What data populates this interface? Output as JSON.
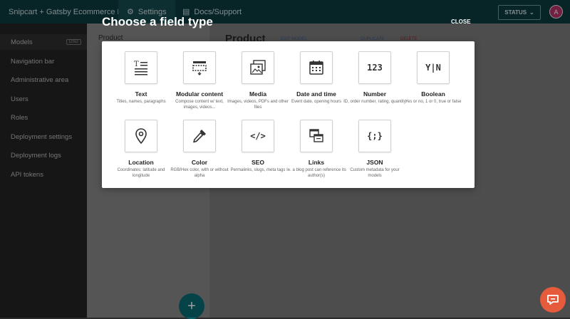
{
  "app": {
    "project_name": "Snipcart + Gatsby Ecommerce Demo",
    "tabs": [
      {
        "label": "Settings",
        "icon": "gear-icon"
      },
      {
        "label": "Docs/Support",
        "icon": "document-icon"
      }
    ],
    "status_label": "STATUS",
    "avatar_initial": "A"
  },
  "sidebar": {
    "items": [
      {
        "label": "Models"
      },
      {
        "label": "Navigation bar"
      },
      {
        "label": "Administrative area"
      },
      {
        "label": "Users"
      },
      {
        "label": "Roles"
      },
      {
        "label": "Deployment settings"
      },
      {
        "label": "Deployment logs"
      },
      {
        "label": "API tokens"
      }
    ],
    "models_badge": "DSD"
  },
  "panel": {
    "left_title": "Product",
    "main_title": "Product",
    "edit_label": "EDIT MODEL",
    "duplicate_label": "DUPLICATE",
    "delete_label": "DELETE",
    "fab_label": "+"
  },
  "modal": {
    "title": "Choose a field type",
    "close_label": "CLOSE",
    "field_types": [
      {
        "label": "Text",
        "desc": "Titles, names, paragraphs",
        "icon": "text-icon"
      },
      {
        "label": "Modular content",
        "desc": "Compose content w/ text, images, videos...",
        "icon": "modular-content-icon"
      },
      {
        "label": "Media",
        "desc": "Images, videos, PDFs and other files",
        "icon": "media-icon"
      },
      {
        "label": "Date and time",
        "desc": "Event date, opening hours",
        "icon": "calendar-icon"
      },
      {
        "label": "Number",
        "desc": "ID, order number, rating, quantity",
        "icon": "number-icon",
        "glyph": "123"
      },
      {
        "label": "Boolean",
        "desc": "Yes or no, 1 or 0, true or false",
        "icon": "boolean-icon",
        "glyph": "Y|N"
      },
      {
        "label": "Location",
        "desc": "Coordinates: latitude and longitude",
        "icon": "location-pin-icon"
      },
      {
        "label": "Color",
        "desc": "RGB/Hex color, with or without alpha",
        "icon": "color-dropper-icon"
      },
      {
        "label": "SEO",
        "desc": "Permalinks, slugs, meta tags",
        "icon": "code-icon",
        "glyph": "</>"
      },
      {
        "label": "Links",
        "desc": "Ie. a blog post can reference its author(s)",
        "icon": "links-icon"
      },
      {
        "label": "JSON",
        "desc": "Custom metadata for your models",
        "icon": "json-icon",
        "glyph": "{;}"
      }
    ]
  }
}
